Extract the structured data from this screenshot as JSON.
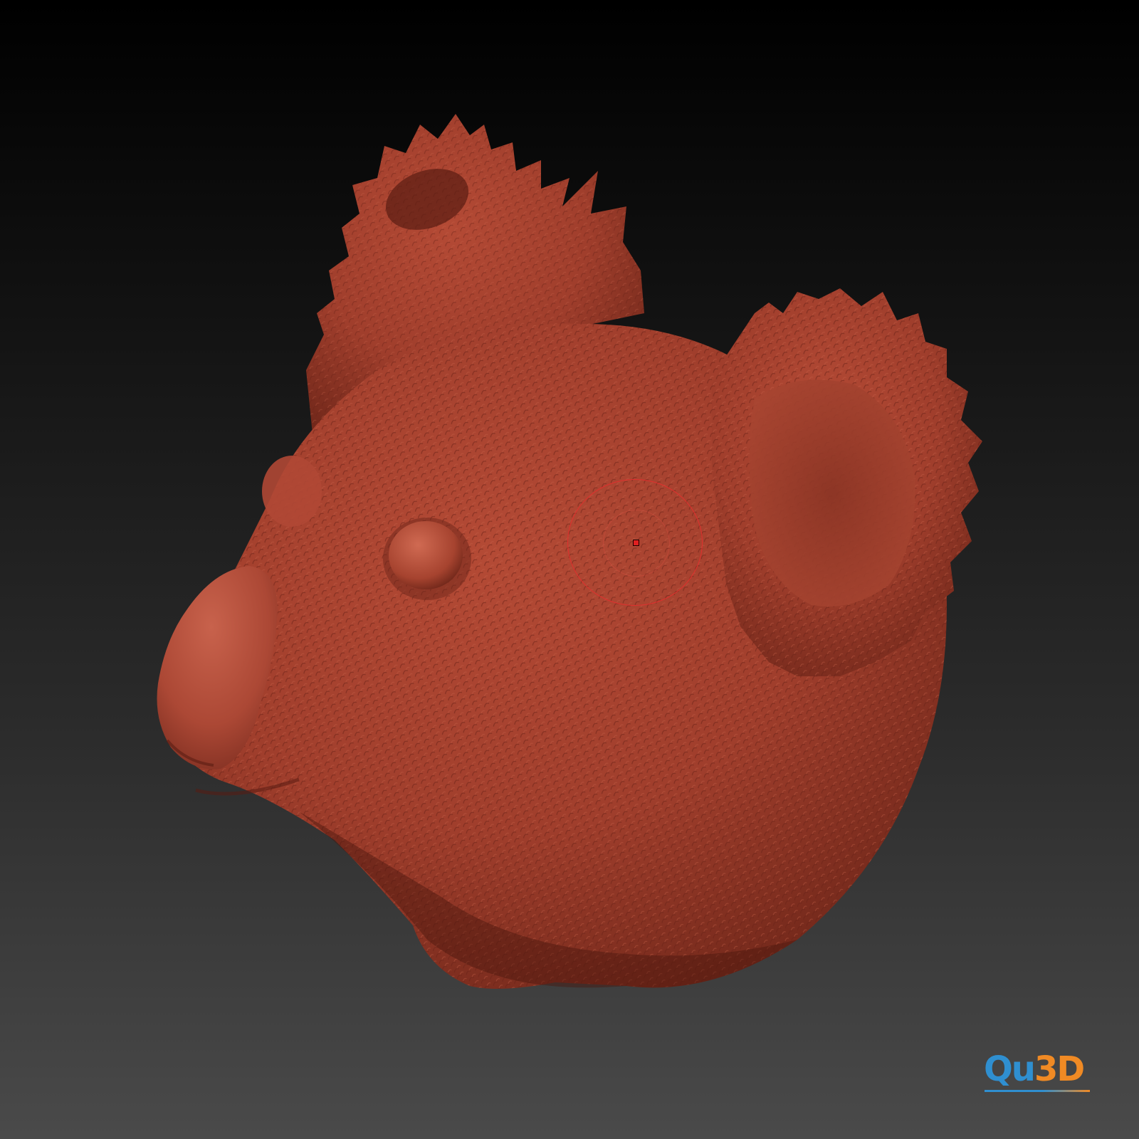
{
  "viewport": {
    "background_top": "#000000",
    "background_bottom": "#4a4a4a"
  },
  "model": {
    "material_color": "#a8402e",
    "highlight_color": "#c65a44",
    "shadow_color": "#5e1f15"
  },
  "brush_cursor": {
    "ring_color": "#e0302e",
    "center_color": "#e02020"
  },
  "watermark": {
    "part1": "Qu",
    "part2": "3D",
    "color1": "#2f8fd0",
    "color2": "#f08a24"
  }
}
